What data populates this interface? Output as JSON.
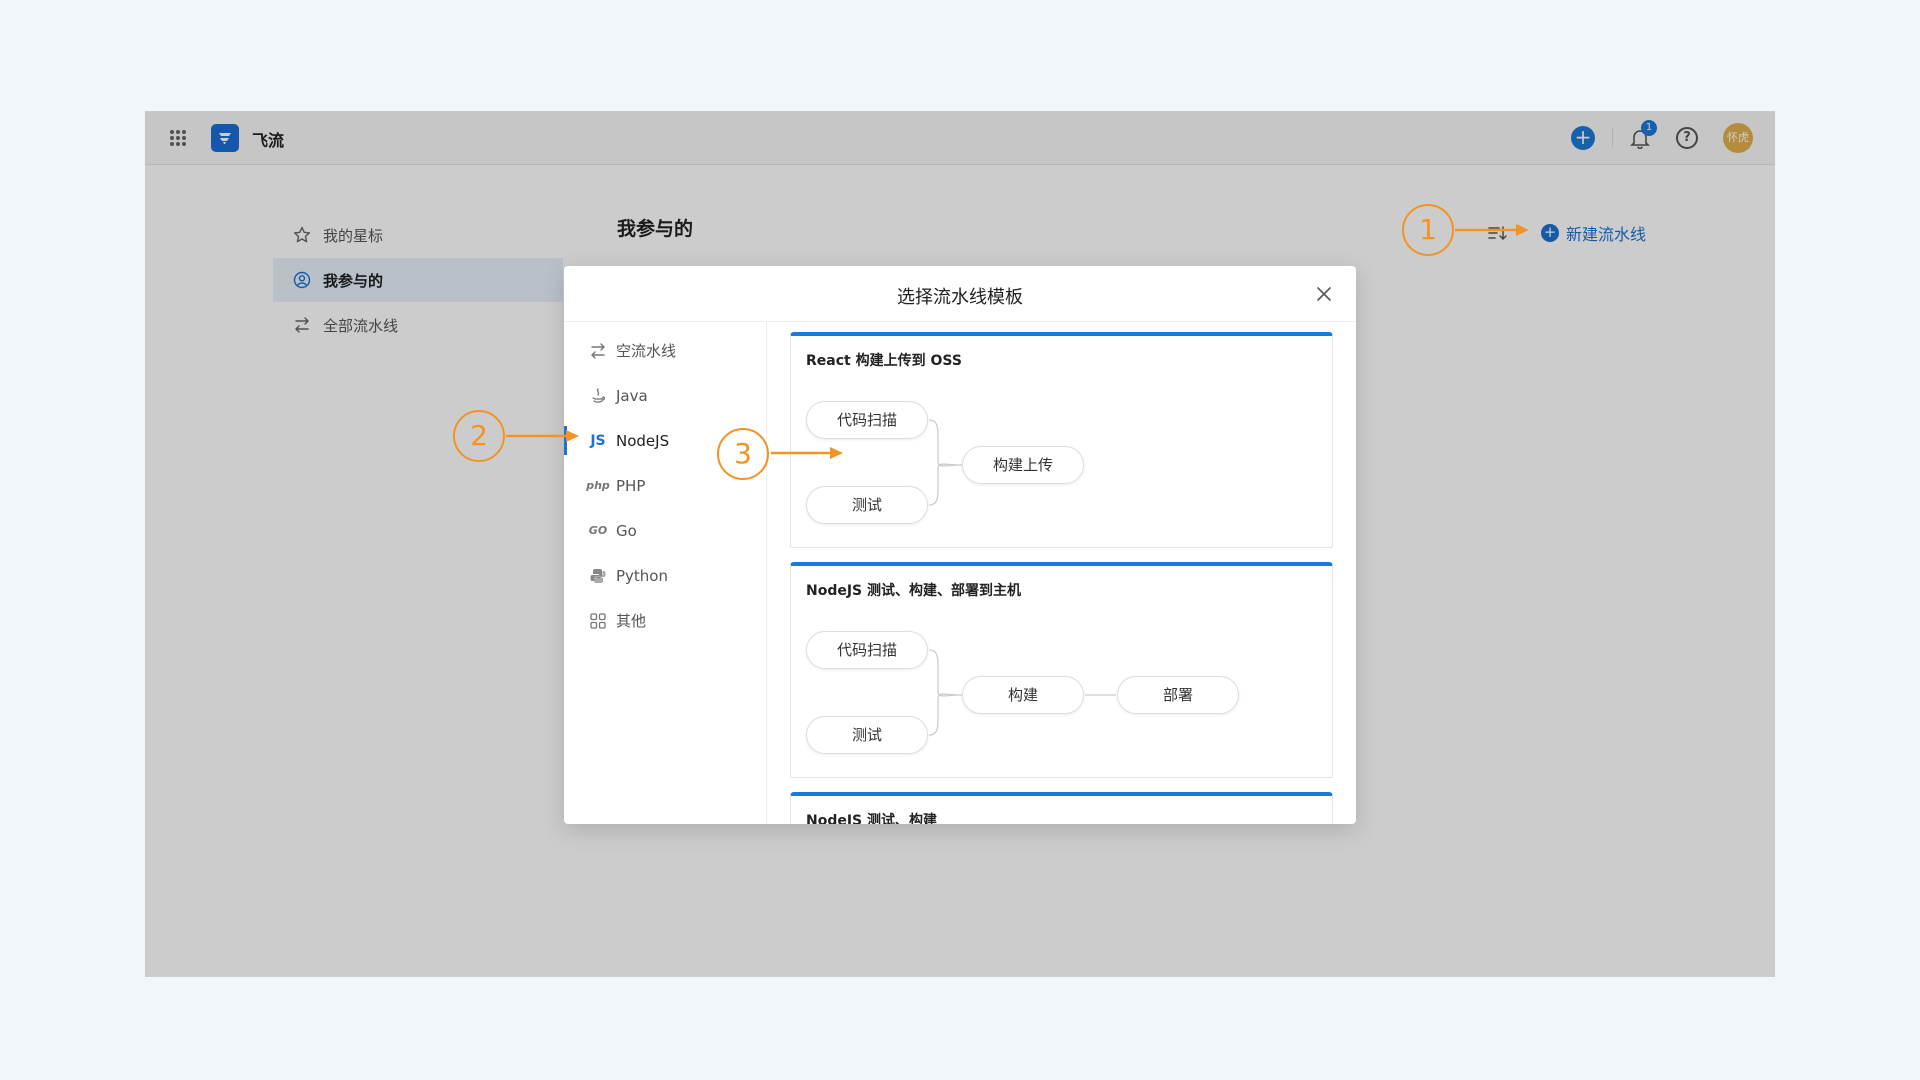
{
  "app": {
    "name": "飞流",
    "avatar_text": "怀虎",
    "notification_count": "1",
    "help_symbol": "?",
    "add_symbol": "+"
  },
  "sidebar": {
    "items": [
      {
        "label": "我的星标",
        "icon": "star-icon",
        "active": false
      },
      {
        "label": "我参与的",
        "icon": "user-circle-icon",
        "active": true
      },
      {
        "label": "全部流水线",
        "icon": "pipeline-icon",
        "active": false
      }
    ]
  },
  "main": {
    "title": "我参与的",
    "new_button_label": "新建流水线"
  },
  "modal": {
    "title": "选择流水线模板",
    "nav": [
      {
        "label": "空流水线",
        "icon": "pipeline-icon"
      },
      {
        "label": "Java",
        "icon": "java-icon"
      },
      {
        "label": "NodeJS",
        "icon": "nodejs-icon",
        "icon_text": "JS",
        "active": true
      },
      {
        "label": "PHP",
        "icon": "php-icon",
        "icon_text": "php"
      },
      {
        "label": "Go",
        "icon": "go-icon",
        "icon_text": "GO"
      },
      {
        "label": "Python",
        "icon": "python-icon"
      },
      {
        "label": "其他",
        "icon": "apps-icon"
      }
    ],
    "templates": [
      {
        "title": "React 构建上传到 OSS",
        "nodes": [
          "代码扫描",
          "测试",
          "构建上传"
        ]
      },
      {
        "title": "NodeJS 测试、构建、部署到主机",
        "nodes": [
          "代码扫描",
          "测试",
          "构建",
          "部署"
        ]
      },
      {
        "title": "NodeJS 测试、构建",
        "nodes": []
      }
    ]
  },
  "annotations": {
    "markers": [
      "1",
      "2",
      "3"
    ],
    "color": "#f29326"
  },
  "colors": {
    "accent": "#1b72d2",
    "background": "#f1f6fa",
    "annotation": "#f29326"
  }
}
